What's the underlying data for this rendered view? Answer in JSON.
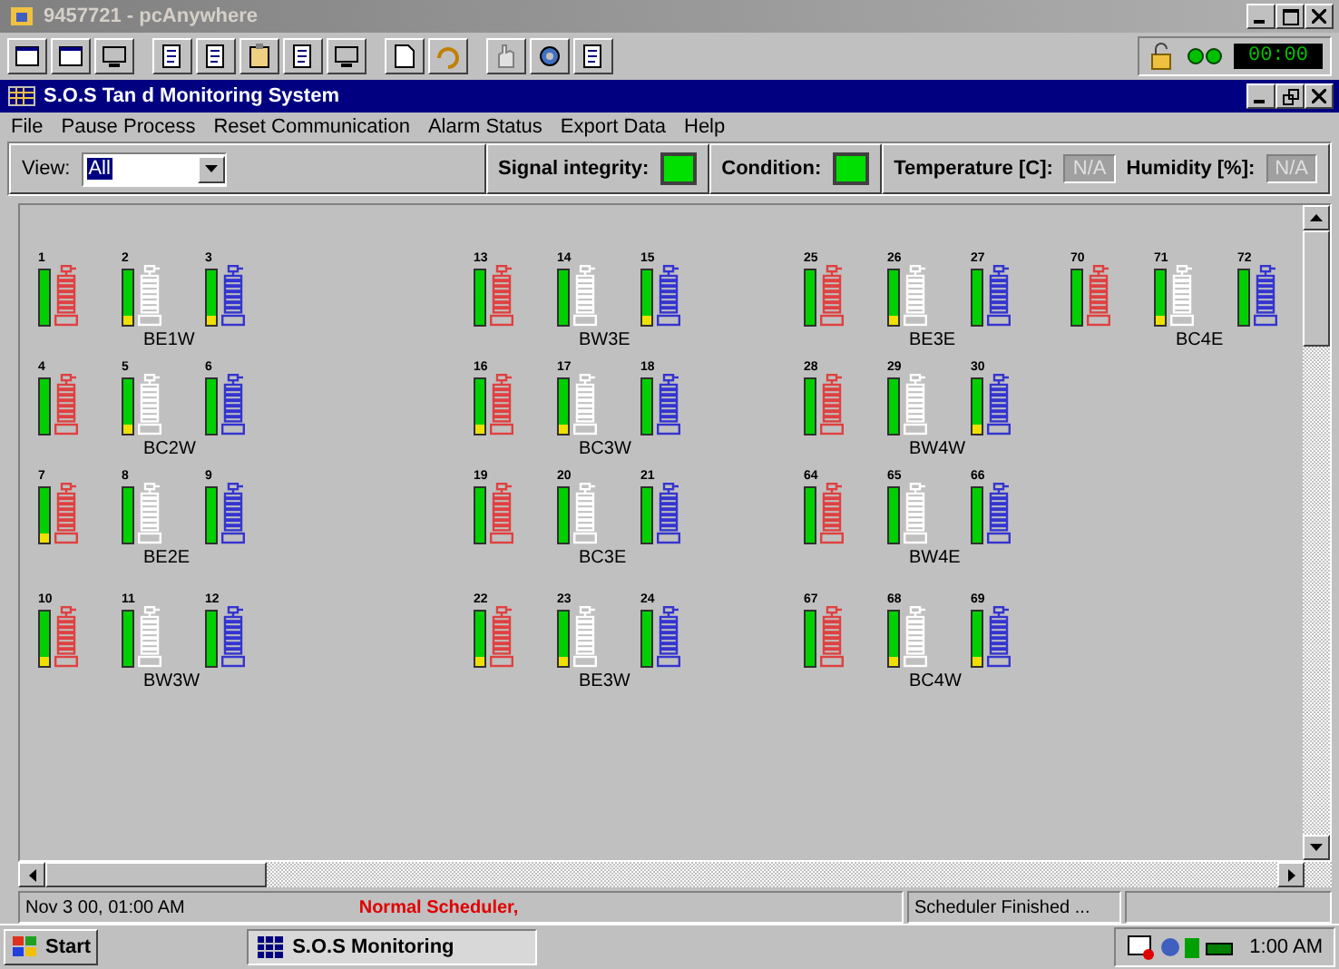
{
  "app_window": {
    "title": "9457721 - pcAnywhere"
  },
  "session_timer": "00:00",
  "inner_window": {
    "title": "S.O.S Tan d Monitoring System"
  },
  "menu": [
    "File",
    "Pause Process",
    "Reset Communication",
    "Alarm Status",
    "Export Data",
    "Help"
  ],
  "toolbar": {
    "view_label": "View:",
    "view_value": "All",
    "signal_label": "Signal integrity:",
    "signal_ok": true,
    "condition_label": "Condition:",
    "condition_ok": true,
    "temperature_label": "Temperature [C]:",
    "temperature_value": "N/A",
    "humidity_label": "Humidity [%]:",
    "humidity_value": "N/A"
  },
  "columns": [
    {
      "groups": [
        {
          "name": "BE1W",
          "sensors": [
            {
              "number": "1",
              "color": "#e04040",
              "warn": false
            },
            {
              "number": "2",
              "color": "#ffffff",
              "warn": true
            },
            {
              "number": "3",
              "color": "#3434d0",
              "warn": true
            }
          ]
        },
        {
          "name": "BC2W",
          "sensors": [
            {
              "number": "4",
              "color": "#e04040",
              "warn": false
            },
            {
              "number": "5",
              "color": "#ffffff",
              "warn": true
            },
            {
              "number": "6",
              "color": "#3434d0",
              "warn": false
            }
          ]
        },
        {
          "name": "BE2E",
          "sensors": [
            {
              "number": "7",
              "color": "#e04040",
              "warn": true
            },
            {
              "number": "8",
              "color": "#ffffff",
              "warn": false
            },
            {
              "number": "9",
              "color": "#3434d0",
              "warn": false
            }
          ]
        },
        {
          "name": "BW3W",
          "sensors": [
            {
              "number": "10",
              "color": "#e04040",
              "warn": true
            },
            {
              "number": "11",
              "color": "#ffffff",
              "warn": false
            },
            {
              "number": "12",
              "color": "#3434d0",
              "warn": false
            }
          ]
        }
      ]
    },
    {
      "groups": [
        {
          "name": "BW3E",
          "sensors": [
            {
              "number": "13",
              "color": "#e04040",
              "warn": false
            },
            {
              "number": "14",
              "color": "#ffffff",
              "warn": false
            },
            {
              "number": "15",
              "color": "#3434d0",
              "warn": true
            }
          ]
        },
        {
          "name": "BC3W",
          "sensors": [
            {
              "number": "16",
              "color": "#e04040",
              "warn": true
            },
            {
              "number": "17",
              "color": "#ffffff",
              "warn": true
            },
            {
              "number": "18",
              "color": "#3434d0",
              "warn": false
            }
          ]
        },
        {
          "name": "BC3E",
          "sensors": [
            {
              "number": "19",
              "color": "#e04040",
              "warn": false
            },
            {
              "number": "20",
              "color": "#ffffff",
              "warn": false
            },
            {
              "number": "21",
              "color": "#3434d0",
              "warn": false
            }
          ]
        },
        {
          "name": "BE3W",
          "sensors": [
            {
              "number": "22",
              "color": "#e04040",
              "warn": true
            },
            {
              "number": "23",
              "color": "#ffffff",
              "warn": true
            },
            {
              "number": "24",
              "color": "#3434d0",
              "warn": false
            }
          ]
        }
      ]
    },
    {
      "groups": [
        {
          "name": "BE3E",
          "sensors": [
            {
              "number": "25",
              "color": "#e04040",
              "warn": false
            },
            {
              "number": "26",
              "color": "#ffffff",
              "warn": true
            },
            {
              "number": "27",
              "color": "#3434d0",
              "warn": false
            }
          ]
        },
        {
          "name": "BW4W",
          "sensors": [
            {
              "number": "28",
              "color": "#e04040",
              "warn": false
            },
            {
              "number": "29",
              "color": "#ffffff",
              "warn": false
            },
            {
              "number": "30",
              "color": "#3434d0",
              "warn": true
            }
          ]
        },
        {
          "name": "BW4E",
          "sensors": [
            {
              "number": "64",
              "color": "#e04040",
              "warn": false
            },
            {
              "number": "65",
              "color": "#ffffff",
              "warn": false
            },
            {
              "number": "66",
              "color": "#3434d0",
              "warn": false
            }
          ]
        },
        {
          "name": "BC4W",
          "sensors": [
            {
              "number": "67",
              "color": "#e04040",
              "warn": false
            },
            {
              "number": "68",
              "color": "#ffffff",
              "warn": true
            },
            {
              "number": "69",
              "color": "#3434d0",
              "warn": true
            }
          ]
        }
      ]
    },
    {
      "groups": [
        {
          "name": "BC4E",
          "sensors": [
            {
              "number": "70",
              "color": "#e04040",
              "warn": false
            },
            {
              "number": "71",
              "color": "#ffffff",
              "warn": true
            },
            {
              "number": "72",
              "color": "#3434d0",
              "warn": false
            }
          ]
        }
      ]
    }
  ],
  "status_bar": {
    "timestamp": "Nov 3 00, 01:00 AM",
    "mode": "Normal Scheduler,",
    "message": "Scheduler Finished ..."
  },
  "taskbar": {
    "start": "Start",
    "task": "S.O.S Monitoring",
    "clock": "1:00 AM"
  }
}
